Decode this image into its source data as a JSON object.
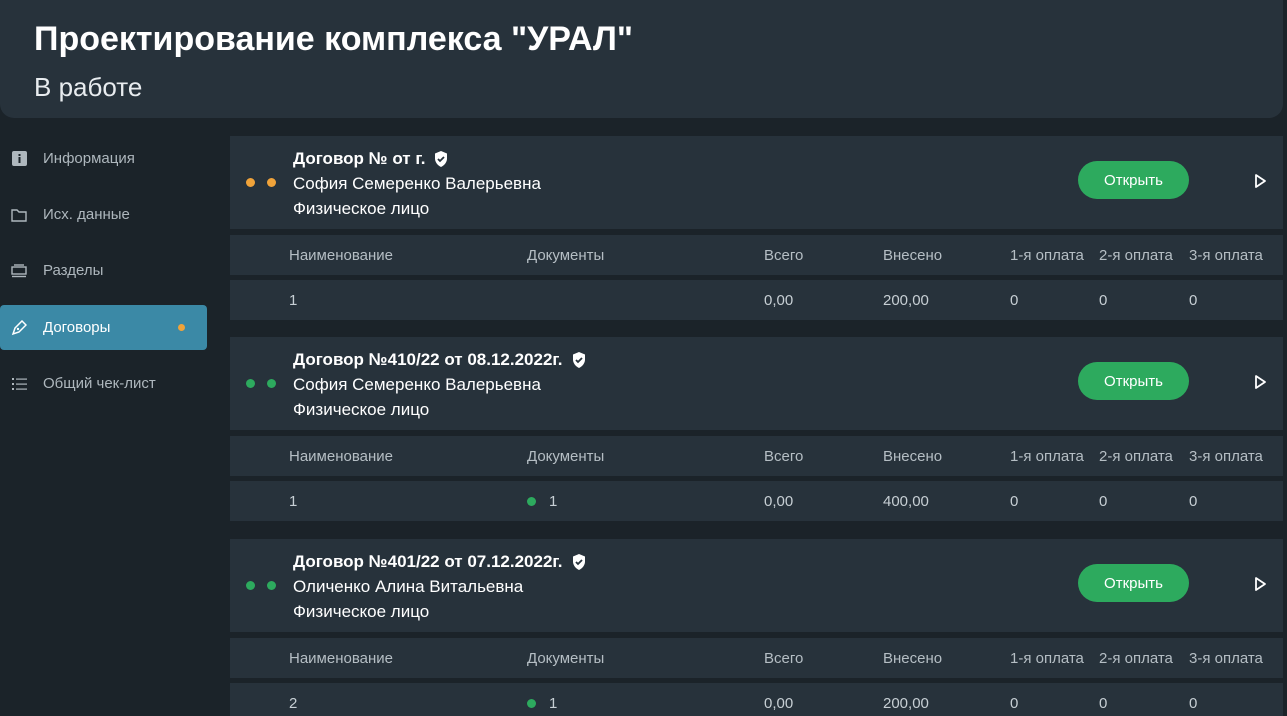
{
  "header": {
    "title": "Проектирование комплекса \"УРАЛ\"",
    "subtitle": "В работе"
  },
  "sidebar": {
    "items": [
      {
        "label": "Информация",
        "icon": "info-icon"
      },
      {
        "label": "Исх. данные",
        "icon": "folder-icon"
      },
      {
        "label": "Разделы",
        "icon": "layers-icon"
      },
      {
        "label": "Договоры",
        "icon": "pen-icon",
        "active": true
      },
      {
        "label": "Общий чек-лист",
        "icon": "checklist-icon"
      }
    ]
  },
  "colors": {
    "accent_active": "#3b89a6",
    "open_button": "#2daa5e",
    "status_orange": "#f0a33a",
    "status_green": "#2daa5e"
  },
  "table_headers": {
    "name": "Наименование",
    "documents": "Документы",
    "total": "Всего",
    "paid": "Внесено",
    "payment1": "1-я оплата",
    "payment2": "2-я оплата",
    "payment3": "3-я оплата"
  },
  "open_label": "Открыть",
  "contracts": [
    {
      "title": "Договор № от г.",
      "person": "София Семеренко Валерьевна",
      "type": "Физическое лицо",
      "status_color": "#f0a33a",
      "row": {
        "name": "1",
        "documents": "",
        "total": "0,00",
        "paid": "200,00",
        "p1": "0",
        "p2": "0",
        "p3": "0"
      }
    },
    {
      "title": "Договор №410/22 от 08.12.2022г.",
      "person": "София Семеренко Валерьевна",
      "type": "Физическое лицо",
      "status_color": "#2daa5e",
      "row": {
        "name": "1",
        "documents": "1",
        "total": "0,00",
        "paid": "400,00",
        "p1": "0",
        "p2": "0",
        "p3": "0"
      }
    },
    {
      "title": "Договор №401/22 от 07.12.2022г.",
      "person": "Оличенко Алина Витальевна",
      "type": "Физическое лицо",
      "status_color": "#2daa5e",
      "row": {
        "name": "2",
        "documents": "1",
        "total": "0,00",
        "paid": "200,00",
        "p1": "0",
        "p2": "0",
        "p3": "0"
      }
    }
  ]
}
